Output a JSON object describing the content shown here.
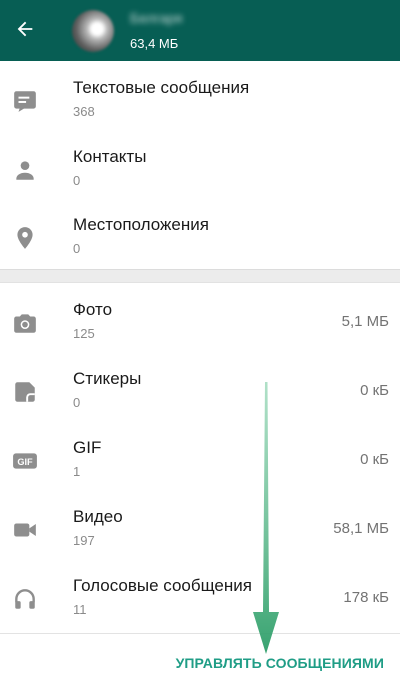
{
  "header": {
    "contact_name": "Белгаря",
    "storage_size": "63,4 МБ"
  },
  "colors": {
    "appbar": "#075e54",
    "accent": "#1f9d86",
    "annotation_arrow": "#4caf7f"
  },
  "sections": [
    {
      "items": [
        {
          "icon": "message-icon",
          "label": "Текстовые сообщения",
          "count": "368",
          "size": ""
        },
        {
          "icon": "person-icon",
          "label": "Контакты",
          "count": "0",
          "size": ""
        },
        {
          "icon": "location-pin-icon",
          "label": "Местоположения",
          "count": "0",
          "size": ""
        }
      ]
    },
    {
      "items": [
        {
          "icon": "camera-icon",
          "label": "Фото",
          "count": "125",
          "size": "5,1 МБ"
        },
        {
          "icon": "sticker-icon",
          "label": "Стикеры",
          "count": "0",
          "size": "0 кБ"
        },
        {
          "icon": "gif-icon",
          "label": "GIF",
          "count": "1",
          "size": "0 кБ"
        },
        {
          "icon": "video-camera-icon",
          "label": "Видео",
          "count": "197",
          "size": "58,1 МБ"
        },
        {
          "icon": "headphones-icon",
          "label": "Голосовые сообщения",
          "count": "11",
          "size": "178 кБ"
        }
      ]
    }
  ],
  "footer": {
    "manage_label": "УПРАВЛЯТЬ СООБЩЕНИЯМИ"
  }
}
